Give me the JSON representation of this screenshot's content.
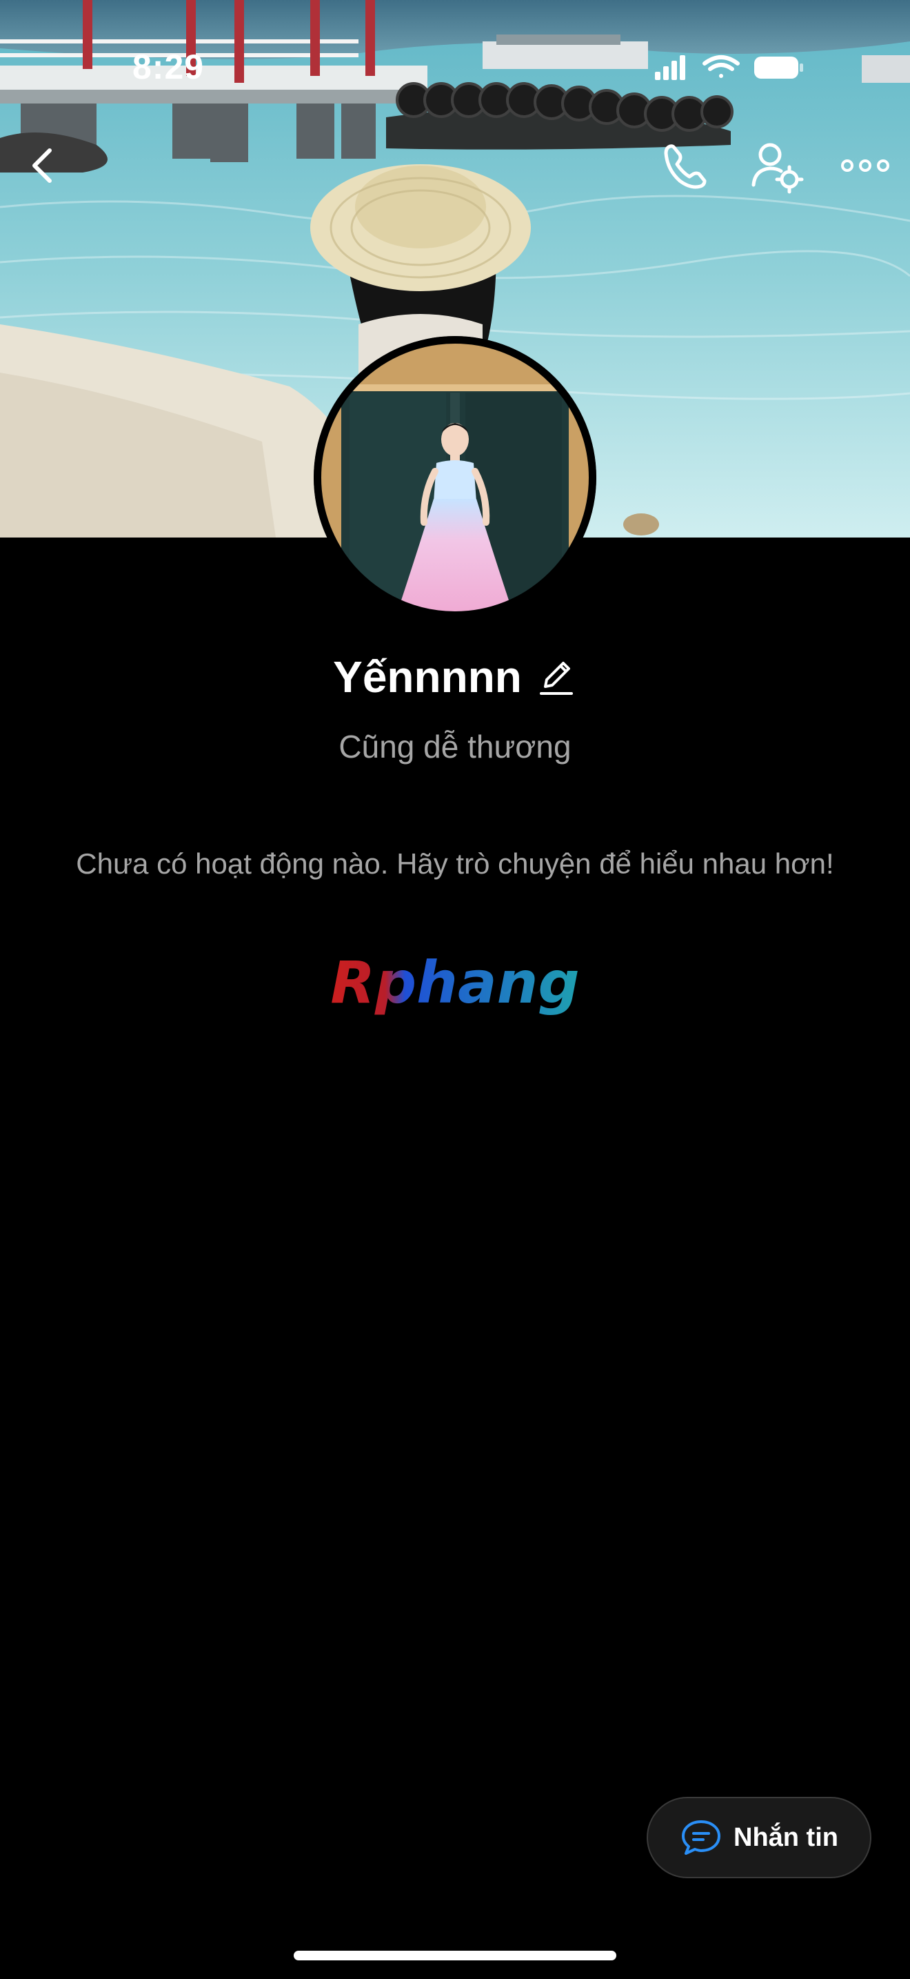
{
  "status_bar": {
    "time": "8:29",
    "icons": [
      "signal-icon",
      "wifi-icon",
      "battery-icon"
    ]
  },
  "navigation": {
    "icons": [
      "back-icon",
      "phone-icon",
      "user-settings-icon",
      "more-icon"
    ]
  },
  "profile": {
    "name": "Yếnnnnn",
    "status": "Cũng dễ thương",
    "empty_activity": "Chưa có hoạt động nào. Hãy trò chuyện để hiểu nhau hơn!"
  },
  "watermark": {
    "text": "Rphang",
    "colors": [
      "#cc1f1f",
      "#1f4fd6",
      "#1fa0b0"
    ]
  },
  "actions": {
    "message_label": "Nhắn tin",
    "message_icon": "chat-bubble-icon",
    "accent_color": "#2a8ff7"
  }
}
